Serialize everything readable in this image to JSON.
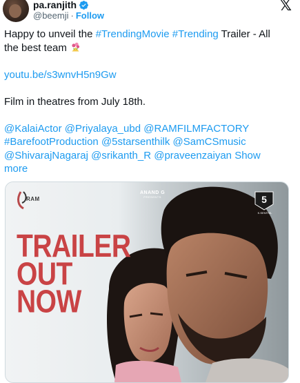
{
  "header": {
    "display_name": "pa.ranjith",
    "handle": "@beemji",
    "separator": "·",
    "follow_label": "Follow",
    "close_glyph": "𝕏",
    "verified_icon": "verified-badge-icon",
    "colors": {
      "accent": "#1d9bf0",
      "text": "#0f1419",
      "muted": "#536471"
    }
  },
  "tweet": {
    "line1_prefix": "Happy to unveil the ",
    "hashtag1": "#TrendingMovie",
    "hashtag2": "#Trending",
    "line1_suffix": " Trailer - All the best team ",
    "emoji_icon": "bouquet-icon",
    "link": "youtu.be/s3wnvH5n9Gw",
    "theatres": "Film in theatres from July 18th.",
    "mention1": "@KalaiActor",
    "mention2": "@Priyalaya_ubd",
    "mention3": "@RAMFILMFACTORY",
    "hashtag3": "#BarefootProduction",
    "mention4": "@5starsenthilk",
    "mention5": "@SamCSmusic",
    "mention6": "@ShivarajNagaraj",
    "mention7": "@srikanth_R",
    "mention8": "@praveenzaiyan",
    "show_more": "Show more"
  },
  "media": {
    "logo_text": "RAM",
    "presenter_name": "ANAND G",
    "presenter_sub": "PRESENTS",
    "badge_name": "K.SENTHIL",
    "poster_lines": [
      "TRAILER",
      "OUT",
      "NOW"
    ],
    "title_color": "#c94345"
  }
}
